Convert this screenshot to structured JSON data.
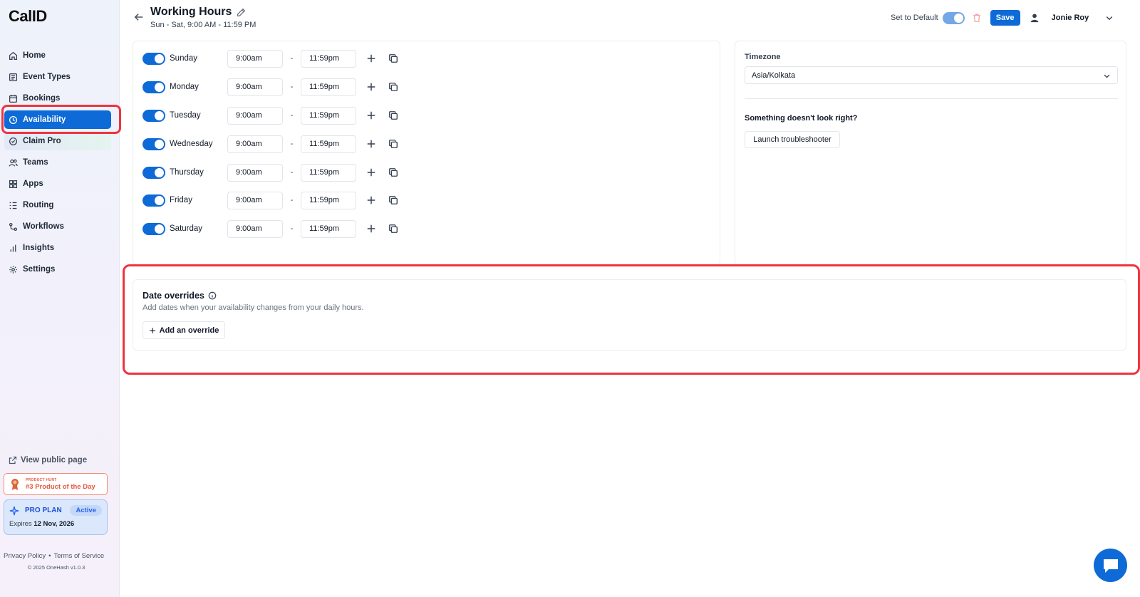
{
  "app": {
    "logo": "CalID"
  },
  "sidebar": {
    "items": [
      {
        "label": "Home",
        "icon": "home-icon"
      },
      {
        "label": "Event Types",
        "icon": "event-types-icon"
      },
      {
        "label": "Bookings",
        "icon": "calendar-icon"
      },
      {
        "label": "Availability",
        "icon": "clock-icon",
        "active": true
      },
      {
        "label": "Claim Pro",
        "icon": "badge-icon"
      },
      {
        "label": "Teams",
        "icon": "users-icon"
      },
      {
        "label": "Apps",
        "icon": "grid-icon"
      },
      {
        "label": "Routing",
        "icon": "routing-icon"
      },
      {
        "label": "Workflows",
        "icon": "workflow-icon"
      },
      {
        "label": "Insights",
        "icon": "bar-chart-icon"
      },
      {
        "label": "Settings",
        "icon": "gear-icon"
      }
    ],
    "view_public_page": "View public page",
    "product_hunt": {
      "small_label": "PRODUCT HUNT",
      "label": "#3 Product of the Day"
    },
    "plan": {
      "name": "PRO PLAN",
      "status": "Active",
      "expires_prefix": "Expires",
      "expires_date": "12 Nov, 2026"
    },
    "footer": {
      "privacy": "Privacy Policy",
      "separator": "•",
      "terms": "Terms of Service",
      "copyright": "© 2025 OneHash v1.0.3"
    }
  },
  "header": {
    "title": "Working Hours",
    "subtitle": "Sun - Sat, 9:00 AM - 11:59 PM",
    "set_default_label": "Set to Default",
    "save_label": "Save",
    "user_name": "Jonie Roy"
  },
  "schedule": {
    "days": [
      {
        "name": "Sunday",
        "enabled": true,
        "start": "9:00am",
        "end": "11:59pm"
      },
      {
        "name": "Monday",
        "enabled": true,
        "start": "9:00am",
        "end": "11:59pm"
      },
      {
        "name": "Tuesday",
        "enabled": true,
        "start": "9:00am",
        "end": "11:59pm"
      },
      {
        "name": "Wednesday",
        "enabled": true,
        "start": "9:00am",
        "end": "11:59pm"
      },
      {
        "name": "Thursday",
        "enabled": true,
        "start": "9:00am",
        "end": "11:59pm"
      },
      {
        "name": "Friday",
        "enabled": true,
        "start": "9:00am",
        "end": "11:59pm"
      },
      {
        "name": "Saturday",
        "enabled": true,
        "start": "9:00am",
        "end": "11:59pm"
      }
    ],
    "separator": "-"
  },
  "timezone": {
    "label": "Timezone",
    "value": "Asia/Kolkata",
    "troubleshoot_title": "Something doesn't look right?",
    "troubleshoot_button": "Launch troubleshooter"
  },
  "overrides": {
    "title": "Date overrides",
    "description": "Add dates when your availability changes from your daily hours.",
    "add_button": "Add an override"
  },
  "colors": {
    "primary": "#0d6ad6",
    "highlight": "#ef3340"
  }
}
